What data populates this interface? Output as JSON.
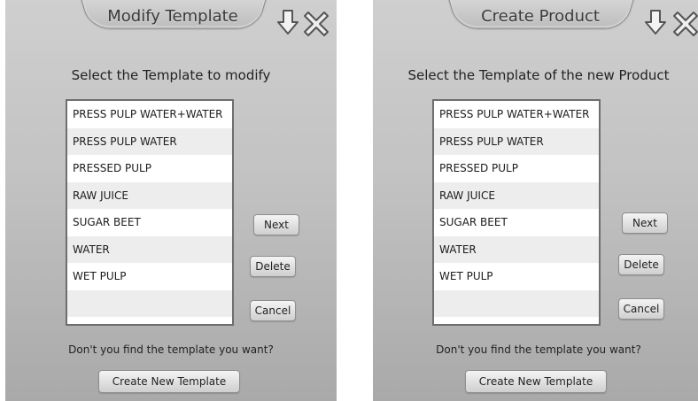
{
  "left": {
    "title": "Modify Template",
    "prompt": "Select the Template to modify",
    "items": [
      "PRESS PULP WATER+WATER",
      "PRESS PULP WATER",
      "PRESSED PULP",
      "RAW JUICE",
      "SUGAR BEET",
      "WATER",
      "WET PULP",
      "",
      ""
    ],
    "next": "Next",
    "delete": "Delete",
    "cancel": "Cancel",
    "footer": "Don't you find the template you want?",
    "create": "Create New Template"
  },
  "right": {
    "title": "Create Product",
    "prompt": "Select the Template of the new Product",
    "items": [
      "PRESS PULP WATER+WATER",
      "PRESS PULP WATER",
      "PRESSED PULP",
      "RAW JUICE",
      "SUGAR BEET",
      "WATER",
      "WET PULP",
      "",
      ""
    ],
    "next": "Next",
    "delete": "Delete",
    "cancel": "Cancel",
    "footer": "Don't you find the template you want?",
    "create": "Create New Template"
  },
  "icons": {
    "down": "down-arrow-icon",
    "close": "close-icon"
  }
}
